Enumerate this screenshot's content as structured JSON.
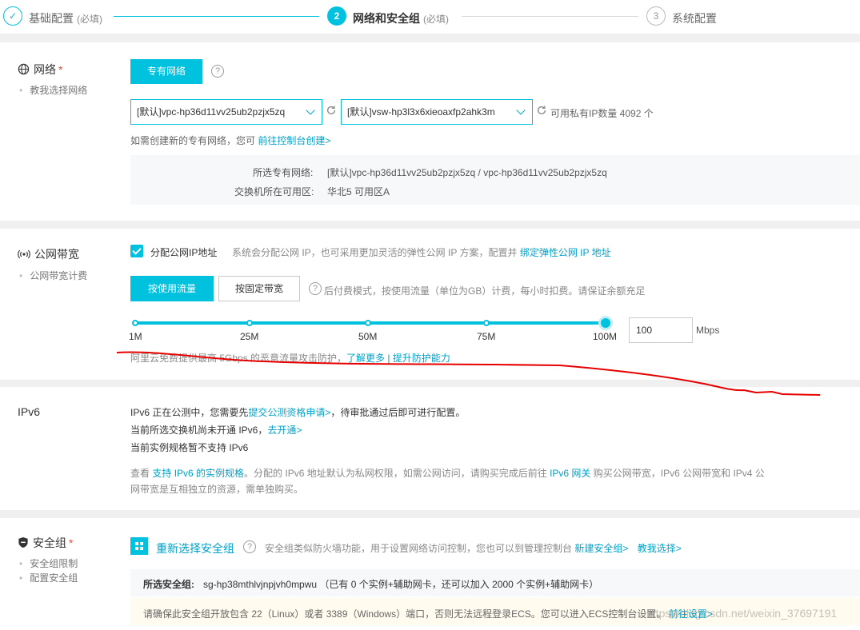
{
  "steps": [
    {
      "index": "✓",
      "label": "基础配置",
      "required": "(必填)"
    },
    {
      "index": "2",
      "label": "网络和安全组",
      "required": "(必填)"
    },
    {
      "index": "3",
      "label": "系统配置",
      "required": ""
    }
  ],
  "network": {
    "title": "网络",
    "required_star": "*",
    "help": "教我选择网络",
    "vpc_button": "专有网络",
    "help_icon": "?",
    "vpc_select": "[默认]vpc-hp36d11vv25ub2pzjx5zq",
    "vsw_select": "[默认]vsw-hp3l3x6xieoaxfp2ahk3m",
    "ip_count": "可用私有IP数量 4092 个",
    "create_hint": "如需创建新的专有网络，您可",
    "create_link": "前往控制台创建>",
    "selected_vpc_label": "所选专有网络:",
    "selected_vpc_value": "[默认]vpc-hp36d11vv25ub2pzjx5zq / vpc-hp36d11vv25ub2pzjx5zq",
    "zone_label": "交换机所在可用区:",
    "zone_value": "华北5 可用区A"
  },
  "bandwidth": {
    "title": "公网带宽",
    "help": "公网带宽计费",
    "assign_ip_label": "分配公网IP地址",
    "assign_ip_desc": "系统会分配公网 IP，也可采用更加灵活的弹性公网 IP 方案，配置并",
    "bind_eip_link": "绑定弹性公网 IP 地址",
    "by_traffic": "按使用流量",
    "by_fixed": "按固定带宽",
    "billing_desc": "后付费模式，按使用流量（单位为GB）计费，每小时扣费。请保证余额充足",
    "slider_ticks": [
      "1M",
      "25M",
      "50M",
      "75M",
      "100M"
    ],
    "slider_value_fraction": 1.0,
    "value": "100",
    "unit": "Mbps",
    "ddos_text": "阿里云免费提供最高 5Gbps 的恶意流量攻击防护，",
    "learn_more": "了解更多",
    "separator": "|",
    "improve_link": "提升防护能力"
  },
  "ipv6": {
    "title": "IPv6",
    "line1_a": "IPv6 正在公测中，您需要先",
    "line1_link": "提交公测资格申请>",
    "line1_b": "，待审批通过后即可进行配置。",
    "line2_a": "当前所选交换机尚未开通 IPv6，",
    "line2_link": "去开通>",
    "line3": "当前实例规格暂不支持 IPv6",
    "note_a": "查看",
    "note_link1": "支持 IPv6 的实例规格",
    "note_b": "。分配的 IPv6 地址默认为私网权限，如需公网访问，请购买完成后前往",
    "note_link2": "IPv6 网关",
    "note_c": "购买公网带宽，IPv6 公网带宽和 IPv4 公",
    "note_line2": "网带宽是互相独立的资源，需单独购买。"
  },
  "security_group": {
    "title": "安全组",
    "required_star": "*",
    "help_items": [
      "安全组限制",
      "配置安全组"
    ],
    "reselect": "重新选择安全组",
    "desc": "安全组类似防火墙功能，用于设置网络访问控制，您也可以到管理控制台",
    "new_link": "新建安全组>",
    "teach_link": "教我选择>",
    "selected_label": "所选安全组:",
    "selected_value": "sg-hp38mthlvjnpjvh0mpwu （已有 0 个实例+辅助网卡，还可以加入 2000 个实例+辅助网卡）",
    "warn_text": "请确保此安全组开放包含 22（Linux）或者 3389（Windows）端口，否则无法远程登录ECS。您可以进入ECS控制台设置。",
    "warn_link": "前往设置>"
  },
  "watermark": "https://blog.csdn.net/weixin_37697191",
  "colors": {
    "accent": "#00c1de",
    "link": "#00a2ca",
    "required": "#e94b3c",
    "annotation": "#e60000"
  }
}
